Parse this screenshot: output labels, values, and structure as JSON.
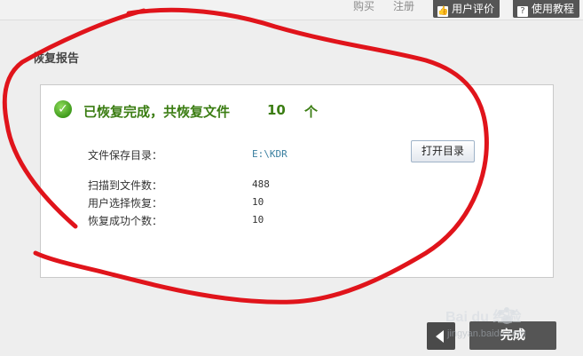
{
  "topnav": {
    "purchase": "购买",
    "register": "注册",
    "user_review": "用户评价",
    "tutorial": "使用教程"
  },
  "section": {
    "title": "恢复报告"
  },
  "result": {
    "headline": "已恢复完成，共恢复文件",
    "count": "10",
    "unit": "个"
  },
  "details": {
    "save_dir_label": "文件保存目录：",
    "save_dir_value": "E:\\KDR",
    "open_dir_button": "打开目录",
    "scanned_label": "扫描到文件数：",
    "scanned_value": "488",
    "selected_label": "用户选择恢复：",
    "selected_value": "10",
    "success_label": "恢复成功个数：",
    "success_value": "10"
  },
  "footer": {
    "done_button": "完成"
  },
  "watermark": {
    "line1": "Bai du 经验",
    "line2": "jingyan.baidu.com"
  },
  "colors": {
    "accent_green": "#3b7d13",
    "annotation_red": "#e0141b",
    "button_dark": "#555555"
  }
}
